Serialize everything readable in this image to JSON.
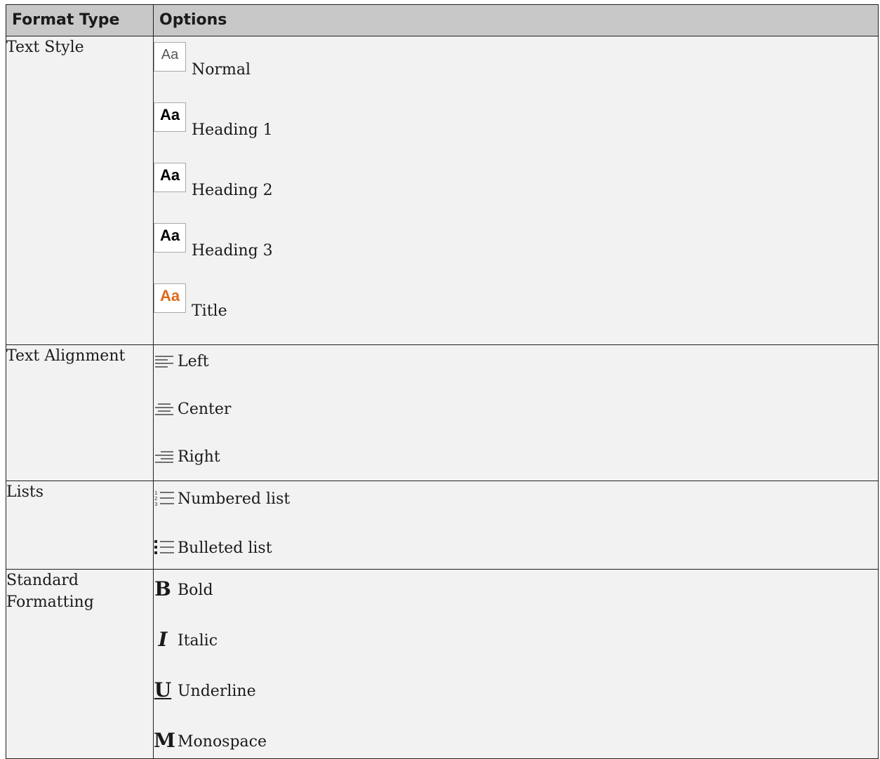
{
  "header": {
    "col_type": "Format Type",
    "col_options": "Options"
  },
  "rows": [
    {
      "type": "Text Style",
      "options": [
        {
          "label": "Normal",
          "icon": "text-style-normal-icon",
          "swatch": "Aa"
        },
        {
          "label": "Heading 1",
          "icon": "text-style-heading-icon",
          "swatch": "Aa"
        },
        {
          "label": "Heading 2",
          "icon": "text-style-heading-icon",
          "swatch": "Aa"
        },
        {
          "label": "Heading 3",
          "icon": "text-style-heading-icon",
          "swatch": "Aa"
        },
        {
          "label": "Title",
          "icon": "text-style-title-icon",
          "swatch": "Aa"
        }
      ]
    },
    {
      "type": "Text Alignment",
      "options": [
        {
          "label": "Left",
          "icon": "align-left-icon"
        },
        {
          "label": "Center",
          "icon": "align-center-icon"
        },
        {
          "label": "Right",
          "icon": "align-right-icon"
        }
      ]
    },
    {
      "type": "Lists",
      "options": [
        {
          "label": "Numbered list",
          "icon": "numbered-list-icon"
        },
        {
          "label": "Bulleted list",
          "icon": "bulleted-list-icon"
        }
      ]
    },
    {
      "type": "Standard Formatting",
      "options": [
        {
          "label": "Bold",
          "icon": "bold-icon",
          "glyph": "B"
        },
        {
          "label": "Italic",
          "icon": "italic-icon",
          "glyph": "I"
        },
        {
          "label": "Underline",
          "icon": "underline-icon",
          "glyph": "U"
        },
        {
          "label": "Monospace",
          "icon": "monospace-icon",
          "glyph": "M"
        }
      ]
    }
  ],
  "colors": {
    "header_bg": "#c8c8c8",
    "cell_bg": "#f2f2f2",
    "title_accent": "#e0691a"
  }
}
